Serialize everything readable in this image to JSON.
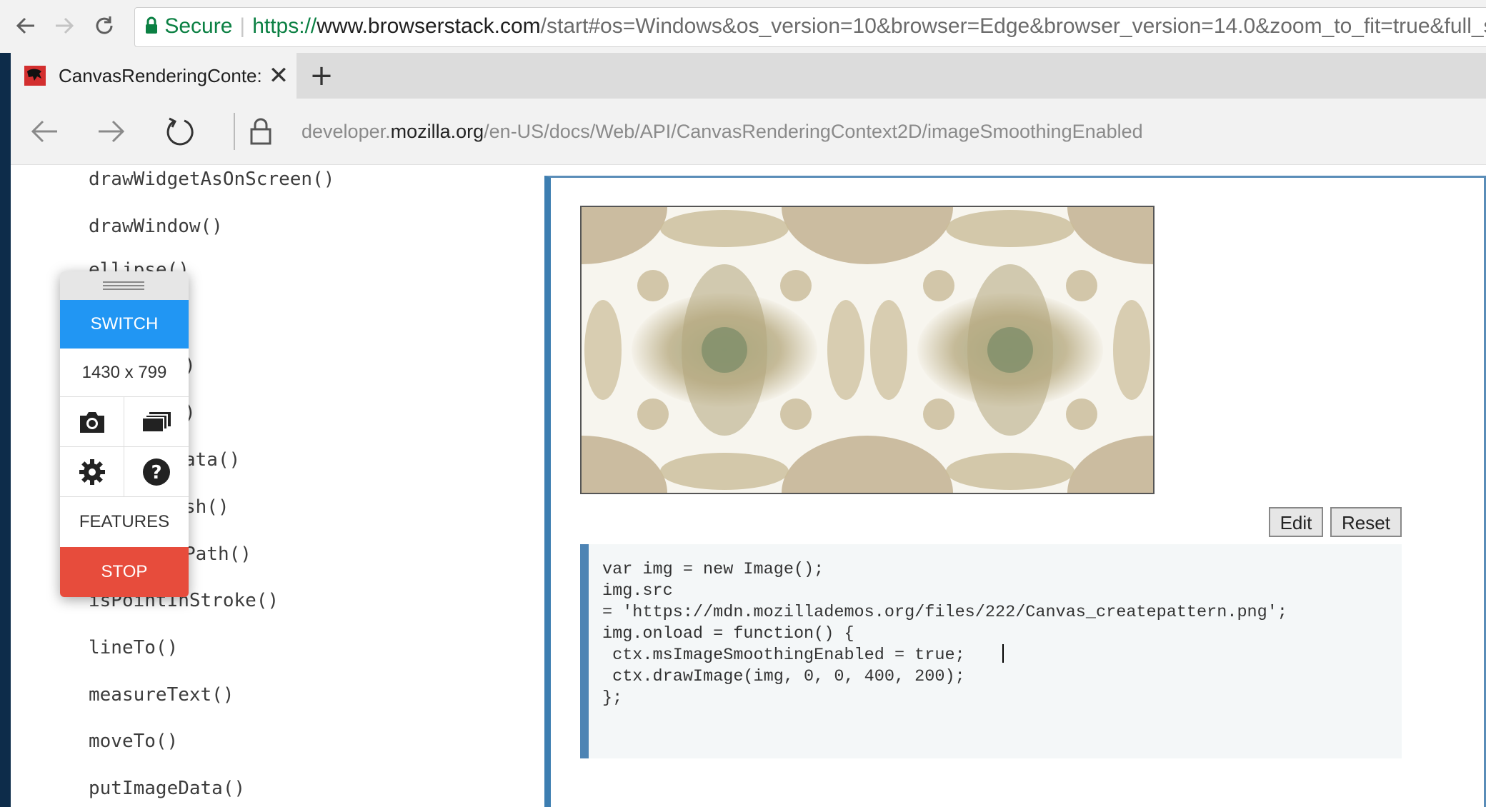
{
  "chrome": {
    "secure_label": "Secure",
    "url_scheme": "https://",
    "url_host": "www.browserstack.com",
    "url_path": "/start#os=Windows&os_version=10&browser=Edge&browser_version=14.0&zoom_to_fit=true&full_scre"
  },
  "edge": {
    "tab_title": "CanvasRenderingConte:",
    "tab_close": "✕",
    "new_tab": "+",
    "url_pre": "developer.",
    "url_host": "mozilla.org",
    "url_path": "/en-US/docs/Web/API/CanvasRenderingContext2D/imageSmoothingEnabled"
  },
  "sidebar": {
    "items": [
      "drawWidgetAsOnScreen()",
      "drawWindow()",
      "ellipse()",
      ")",
      ")",
      "ata()",
      "sh()",
      "Path()",
      "isPointInStroke()",
      "lineTo()",
      "measureText()",
      "moveTo()",
      "putImageData()"
    ]
  },
  "live": {
    "edit_label": "Edit",
    "reset_label": "Reset",
    "code": [
      "var img = new Image();",
      "img.src",
      "= 'https://mdn.mozillademos.org/files/222/Canvas_createpattern.png';",
      "img.onload = function() {",
      " ctx.msImageSmoothingEnabled = true;",
      " ctx.drawImage(img, 0, 0, 400, 200);",
      "};"
    ]
  },
  "widget": {
    "switch_label": "SWITCH",
    "resolution": "1430 x 799",
    "features_label": "FEATURES",
    "stop_label": "STOP",
    "icons": [
      "camera-icon",
      "screens-icon",
      "gear-icon",
      "help-icon"
    ]
  },
  "colors": {
    "switch": "#2196f3",
    "stop": "#e74c3c",
    "secure": "#0b8043",
    "frame_accent": "#3d7eb1"
  }
}
